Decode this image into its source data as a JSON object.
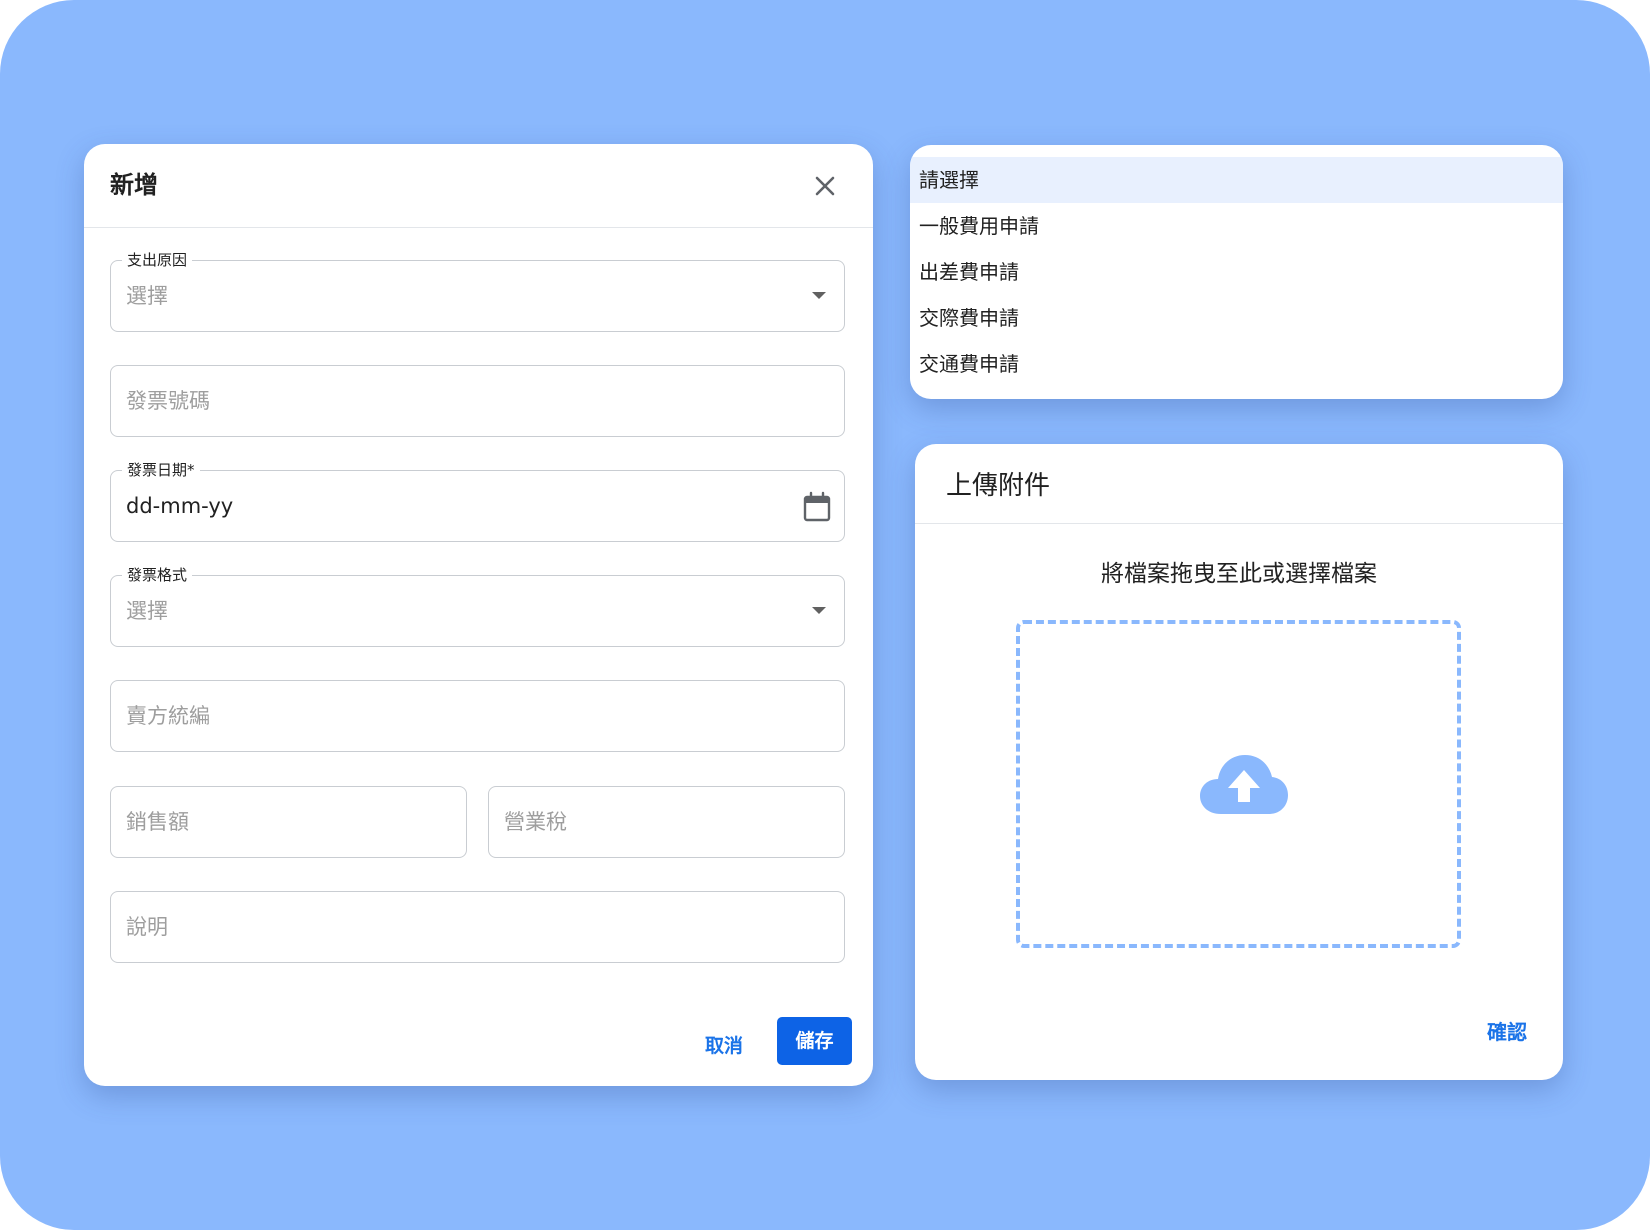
{
  "dialog": {
    "title": "新增",
    "fields": {
      "reason": {
        "label": "支出原因",
        "value": "選擇"
      },
      "invoice_number": {
        "placeholder": "發票號碼"
      },
      "invoice_date": {
        "label": "發票日期*",
        "value": "dd-mm-yy"
      },
      "invoice_format": {
        "label": "發票格式",
        "value": "選擇"
      },
      "seller_tax_id": {
        "placeholder": "賣方統編"
      },
      "sales_amount": {
        "placeholder": "銷售額"
      },
      "business_tax": {
        "placeholder": "營業稅"
      },
      "description": {
        "placeholder": "說明"
      }
    },
    "cancel_label": "取消",
    "save_label": "儲存"
  },
  "dropdown": {
    "items": [
      {
        "label": "請選擇"
      },
      {
        "label": "一般費用申請"
      },
      {
        "label": "出差費申請"
      },
      {
        "label": "交際費申請"
      },
      {
        "label": "交通費申請"
      }
    ],
    "selected_index": 0
  },
  "upload": {
    "title": "上傳附件",
    "hint": "將檔案拖曳至此或選擇檔案",
    "icon": "cloud-upload-icon",
    "confirm_label": "確認"
  },
  "colors": {
    "background": "#8ab8fd",
    "primary": "#0d63e6",
    "link": "#1a73e8",
    "selected_item": "#e8f0fe"
  }
}
